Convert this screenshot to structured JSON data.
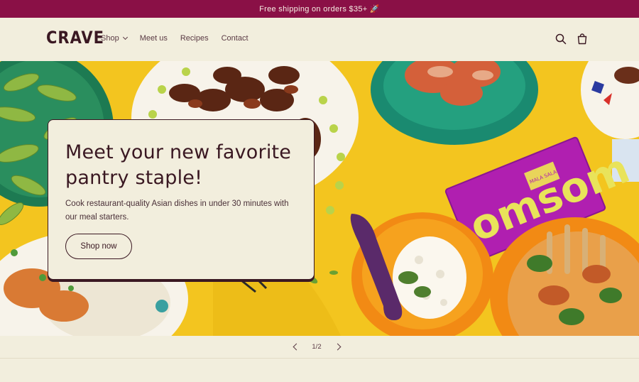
{
  "announcement": {
    "text": "Free shipping on orders $35+ 🚀"
  },
  "header": {
    "logo": "CRAVE",
    "nav": [
      {
        "label": "Shop",
        "has_dropdown": true
      },
      {
        "label": "Meet us"
      },
      {
        "label": "Recipes"
      },
      {
        "label": "Contact"
      }
    ],
    "icons": [
      "search-icon",
      "cart-icon"
    ]
  },
  "hero": {
    "title": "Meet your new favorite pantry staple!",
    "subtitle": "Cook restaurant-quality Asian dishes in under 30 minutes with our meal starters.",
    "cta_label": "Shop now",
    "package_brand": "omsom",
    "package_flavor": "MALA SALAD"
  },
  "slider": {
    "counter": "1/2"
  },
  "colors": {
    "announcement_bg": "#8a1046",
    "page_bg": "#f2eedd",
    "hero_bg": "#f2c21c",
    "text": "#3a1822"
  }
}
